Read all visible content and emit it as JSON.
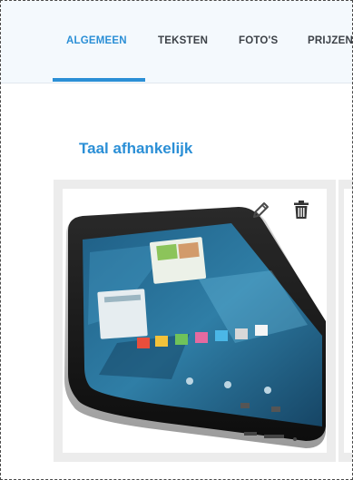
{
  "tabs": [
    {
      "label": "ALGEMEEN",
      "active": true
    },
    {
      "label": "TEKSTEN",
      "active": false
    },
    {
      "label": "FOTO'S",
      "active": false
    },
    {
      "label": "PRIJZEN",
      "active": false
    }
  ],
  "section": {
    "title": "Taal afhankelijk"
  },
  "photo_card": {
    "image": "tablet-photo",
    "actions": [
      "edit-icon",
      "delete-icon"
    ]
  },
  "colors": {
    "accent": "#2b8fd6",
    "tab_text": "#3c4147",
    "tabbar_bg": "#f4f9fd",
    "card_bg": "#ececec"
  }
}
